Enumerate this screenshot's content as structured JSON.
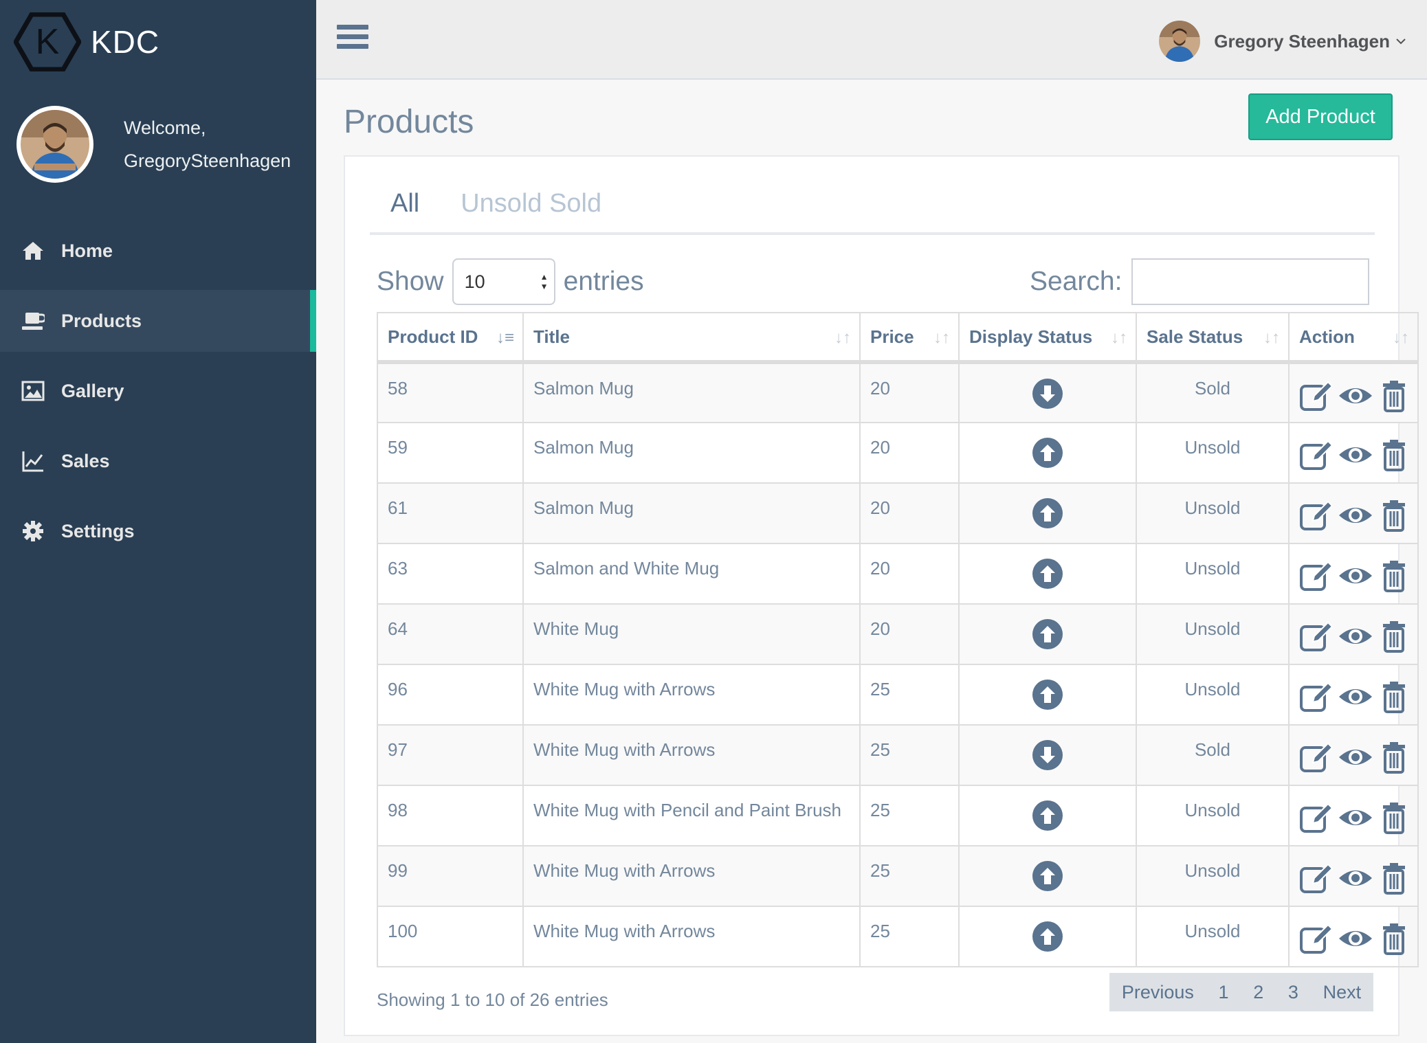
{
  "brand": {
    "name": "KDC",
    "logo_letter": "K"
  },
  "profile": {
    "welcome": "Welcome,",
    "username": "GregorySteenhagen"
  },
  "nav": [
    {
      "label": "Home",
      "icon": "home-icon"
    },
    {
      "label": "Products",
      "icon": "laptop-icon",
      "active": true
    },
    {
      "label": "Gallery",
      "icon": "image-icon"
    },
    {
      "label": "Sales",
      "icon": "line-chart-icon"
    },
    {
      "label": "Settings",
      "icon": "gear-icon"
    }
  ],
  "topbar": {
    "user_name": "Gregory Steenhagen"
  },
  "page": {
    "title": "Products",
    "add_button": "Add Product"
  },
  "tabs": [
    {
      "label": "All",
      "active": true
    },
    {
      "label": "Unsold Sold",
      "active": false
    }
  ],
  "controls": {
    "show_label": "Show",
    "entries_value": "10",
    "entries_label": "entries",
    "search_label": "Search:",
    "search_value": ""
  },
  "table": {
    "headers": [
      "Product ID",
      "Title",
      "Price",
      "Display Status",
      "Sale Status",
      "Action"
    ],
    "rows": [
      {
        "id": "58",
        "title": "Salmon Mug",
        "price": "20",
        "display": "down",
        "sale": "Sold"
      },
      {
        "id": "59",
        "title": "Salmon Mug",
        "price": "20",
        "display": "up",
        "sale": "Unsold"
      },
      {
        "id": "61",
        "title": "Salmon Mug",
        "price": "20",
        "display": "up",
        "sale": "Unsold"
      },
      {
        "id": "63",
        "title": "Salmon and White Mug",
        "price": "20",
        "display": "up",
        "sale": "Unsold"
      },
      {
        "id": "64",
        "title": "White Mug",
        "price": "20",
        "display": "up",
        "sale": "Unsold"
      },
      {
        "id": "96",
        "title": "White Mug with Arrows",
        "price": "25",
        "display": "up",
        "sale": "Unsold"
      },
      {
        "id": "97",
        "title": "White Mug with Arrows",
        "price": "25",
        "display": "down",
        "sale": "Sold"
      },
      {
        "id": "98",
        "title": "White Mug with Pencil and Paint Brush",
        "price": "25",
        "display": "up",
        "sale": "Unsold"
      },
      {
        "id": "99",
        "title": "White Mug with Arrows",
        "price": "25",
        "display": "up",
        "sale": "Unsold"
      },
      {
        "id": "100",
        "title": "White Mug with Arrows",
        "price": "25",
        "display": "up",
        "sale": "Unsold"
      }
    ]
  },
  "footer": {
    "info": "Showing 1 to 10 of 26 entries",
    "pager": {
      "previous": "Previous",
      "pages": [
        "1",
        "2",
        "3"
      ],
      "next": "Next"
    }
  },
  "colors": {
    "sidebar": "#2a3f54",
    "accent": "#1abb9c",
    "button": "#26b99a",
    "text": "#73879c",
    "icon": "#5a738e"
  }
}
